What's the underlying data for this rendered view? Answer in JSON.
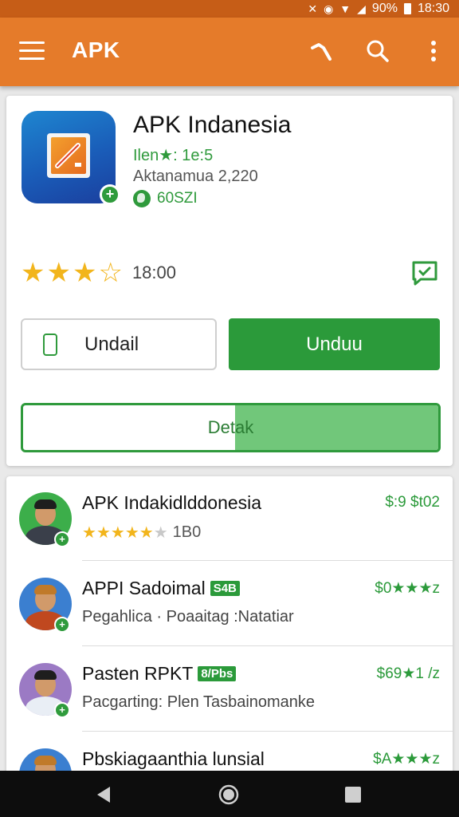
{
  "status_bar": {
    "battery": "90%",
    "time": "18:30"
  },
  "app_bar": {
    "title": "APK"
  },
  "app_detail": {
    "name": "APK Indanesia",
    "subtitle": "Ilen★: 1e:5",
    "meta": "Aktanamua 2,220",
    "size": "60SZI",
    "rating_text": "18:00",
    "stars": 4,
    "button_secondary": "Undail",
    "button_primary": "Unduu",
    "progress_label": "Detak",
    "progress_fraction": 0.49
  },
  "list": [
    {
      "title": "APK Indakidlddonesia",
      "tag": "",
      "price": "$:9 $t02",
      "stars": 5,
      "rating_text": "1B0",
      "subtitle": ""
    },
    {
      "title": "APPI Sadoimal",
      "tag": "S4B",
      "price": "$0★★★z",
      "stars": 0,
      "rating_text": "",
      "subtitle": "Pegahlica · Poaaitag :Natatiar"
    },
    {
      "title": "Pasten RPKT",
      "tag": "8/Pbs",
      "price": "$69★1 /z",
      "stars": 0,
      "rating_text": "",
      "subtitle": "Pacgarting: Plen Tasbainomanke"
    },
    {
      "title": "Pbskiagaanthia lunsial",
      "tag": "",
      "price": "$A★★★z",
      "stars": 0,
      "rating_text": "",
      "subtitle": ""
    }
  ],
  "colors": {
    "appbar": "#e57b2a",
    "statusbar": "#c65d17",
    "accent_green": "#2b9a3a",
    "star": "#f2b51c"
  }
}
